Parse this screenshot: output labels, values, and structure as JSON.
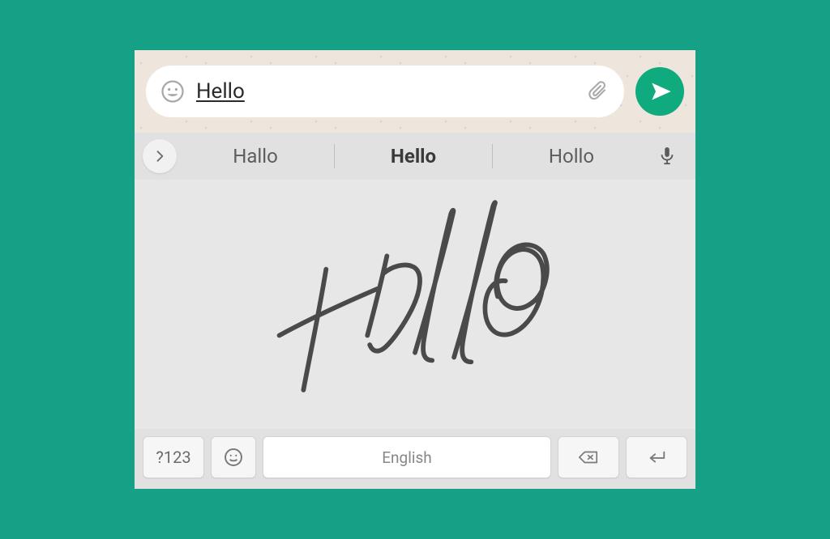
{
  "chat": {
    "message_value": "Hello",
    "emoji_icon": "emoji-face",
    "attach_icon": "paperclip",
    "send_icon": "send"
  },
  "keyboard": {
    "expand_icon": "chevron-right",
    "suggestions": [
      "Hallo",
      "Hello",
      "Hollo"
    ],
    "selected_index": 1,
    "mic_icon": "microphone",
    "handwriting_text": "Hollo",
    "bottom": {
      "symbols_label": "?123",
      "emoji_icon": "emoji-face-outline",
      "space_label": "English",
      "backspace_icon": "backspace",
      "enter_icon": "enter"
    }
  },
  "colors": {
    "accent": "#0faa7e",
    "page_bg": "#16a085",
    "kb_bg": "#e1e1e1"
  }
}
